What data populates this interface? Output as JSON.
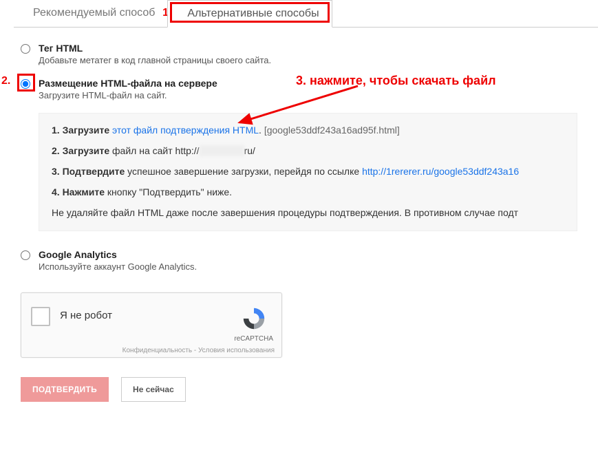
{
  "tabs": {
    "recommended": "Рекомендуемый способ",
    "alternative": "Альтернативные способы"
  },
  "annotations": {
    "n1": "1.",
    "n2": "2.",
    "n3": "3. нажмите, чтобы скачать файл"
  },
  "options": {
    "html_tag": {
      "title": "Тег HTML",
      "desc": "Добавьте метатег в код главной страницы своего сайта."
    },
    "html_file": {
      "title": "Размещение HTML-файла на сервере",
      "desc": "Загрузите HTML-файл на сайт."
    },
    "ga": {
      "title": "Google Analytics",
      "desc": "Используйте аккаунт Google Analytics."
    }
  },
  "steps": {
    "s1_prefix": "1. Загрузите ",
    "s1_link": "этот файл подтверждения HTML",
    "s1_dot": ". ",
    "s1_file": "[google53ddf243a16ad95f.html]",
    "s2_prefix": "2. Загрузите",
    "s2_rest": " файл на сайт http://",
    "s2_suffix": "ru/",
    "s3_prefix": "3. Подтвердите",
    "s3_rest": " успешное завершение загрузки, перейдя по ссылке ",
    "s3_link": "http://1rererer.ru/google53ddf243a16",
    "s4_prefix": "4. Нажмите",
    "s4_rest": " кнопку \"Подтвердить\" ниже.",
    "note": "Не удаляйте файл HTML даже после завершения процедуры подтверждения. В противном случае подт"
  },
  "captcha": {
    "label": "Я не робот",
    "brand": "reCAPTCHA",
    "terms": "Конфиденциальность - Условия использования"
  },
  "buttons": {
    "confirm": "ПОДТВЕРДИТЬ",
    "later": "Не сейчас"
  }
}
